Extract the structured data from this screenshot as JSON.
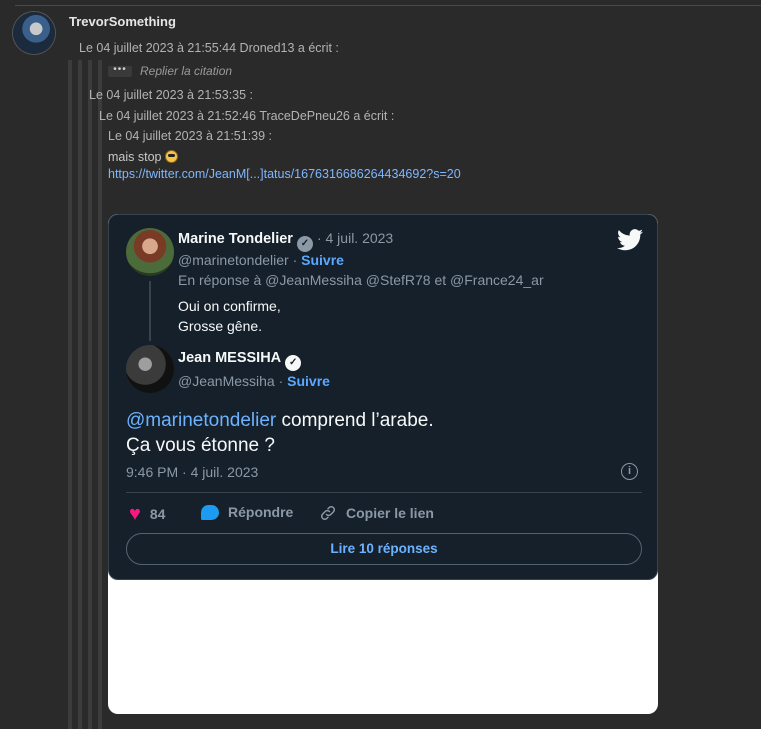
{
  "post": {
    "author": "TrevorSomething",
    "quote_lines": [
      "Le 04 juillet 2023 à 21:55:44 Droned13 a écrit :",
      "Le 04 juillet 2023 à 21:53:35 :",
      "Le 04 juillet 2023 à 21:52:46 TraceDePneu26 a écrit :",
      "Le 04 juillet 2023 à 21:51:39 :"
    ],
    "collapse_dots": "•••",
    "collapse_label": "Replier la citation",
    "message": "mais stop",
    "link": "https://twitter.com/JeanM[...]tatus/1676316686264434692?s=20"
  },
  "tweet": {
    "author1": {
      "name": "Marine Tondelier",
      "date": "· 4 juil. 2023",
      "handle": "@marinetondelier ·",
      "follow": "Suivre",
      "in_reply": "En réponse à @JeanMessiha @StefR78  et  @France24_ar",
      "text_lines": [
        "Oui on confirme,",
        "Grosse gêne."
      ]
    },
    "author2": {
      "name": "Jean MESSIHA",
      "handle": "@JeanMessiha ·",
      "follow": "Suivre"
    },
    "main_mention": "@marinetondelier",
    "main_text_1": " comprend l’arabe.",
    "main_text_2": "Ça vous étonne ?",
    "timestamp": "9:46 PM · 4 juil. 2023",
    "likes": "84",
    "reply_label": "Répondre",
    "copy_label": "Copier le lien",
    "read_button": "Lire 10 réponses",
    "colors": {
      "bg": "#15202b",
      "accent": "#1d9bf0",
      "like": "#f91880"
    }
  }
}
